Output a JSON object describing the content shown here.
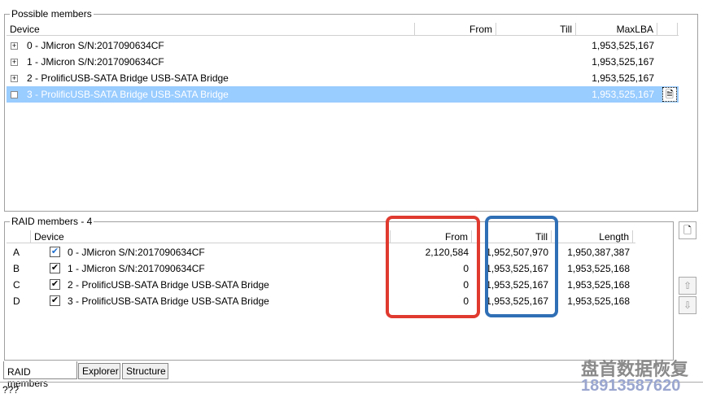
{
  "possible": {
    "title": "Possible members",
    "columns": [
      "Device",
      "From",
      "Till",
      "MaxLBA"
    ],
    "rows": [
      {
        "device": "0 - JMicron S/N:2017090634CF",
        "from": "",
        "till": "",
        "maxlba": "1,953,525,167"
      },
      {
        "device": "1 - JMicron S/N:2017090634CF",
        "from": "",
        "till": "",
        "maxlba": "1,953,525,167"
      },
      {
        "device": "2 - ProlificUSB-SATA Bridge USB-SATA Bridge",
        "from": "",
        "till": "",
        "maxlba": "1,953,525,167"
      },
      {
        "device": "3 - ProlificUSB-SATA Bridge USB-SATA Bridge",
        "from": "",
        "till": "",
        "maxlba": "1,953,525,167"
      }
    ]
  },
  "raid": {
    "title": "RAID members - 4",
    "columns": [
      "",
      "Device",
      "From",
      "Till",
      "Length"
    ],
    "rows": [
      {
        "letter": "A",
        "device": "0 - JMicron S/N:2017090634CF",
        "from": "2,120,584",
        "till": "1,952,507,970",
        "length": "1,950,387,387"
      },
      {
        "letter": "B",
        "device": "1 - JMicron S/N:2017090634CF",
        "from": "0",
        "till": "1,953,525,167",
        "length": "1,953,525,168"
      },
      {
        "letter": "C",
        "device": "2 - ProlificUSB-SATA Bridge USB-SATA Bridge",
        "from": "0",
        "till": "1,953,525,167",
        "length": "1,953,525,168"
      },
      {
        "letter": "D",
        "device": "3 - ProlificUSB-SATA Bridge USB-SATA Bridge",
        "from": "0",
        "till": "1,953,525,167",
        "length": "1,953,525,168"
      }
    ]
  },
  "tabs": [
    "RAID members",
    "Explorer",
    "Structure"
  ],
  "status": "???",
  "watermark": {
    "name": "盘首数据恢复",
    "phone": "18913587620"
  },
  "colors": {
    "selection": "#99ccff",
    "red_box": "#e03a2f",
    "blue_box": "#2f6fb5"
  }
}
